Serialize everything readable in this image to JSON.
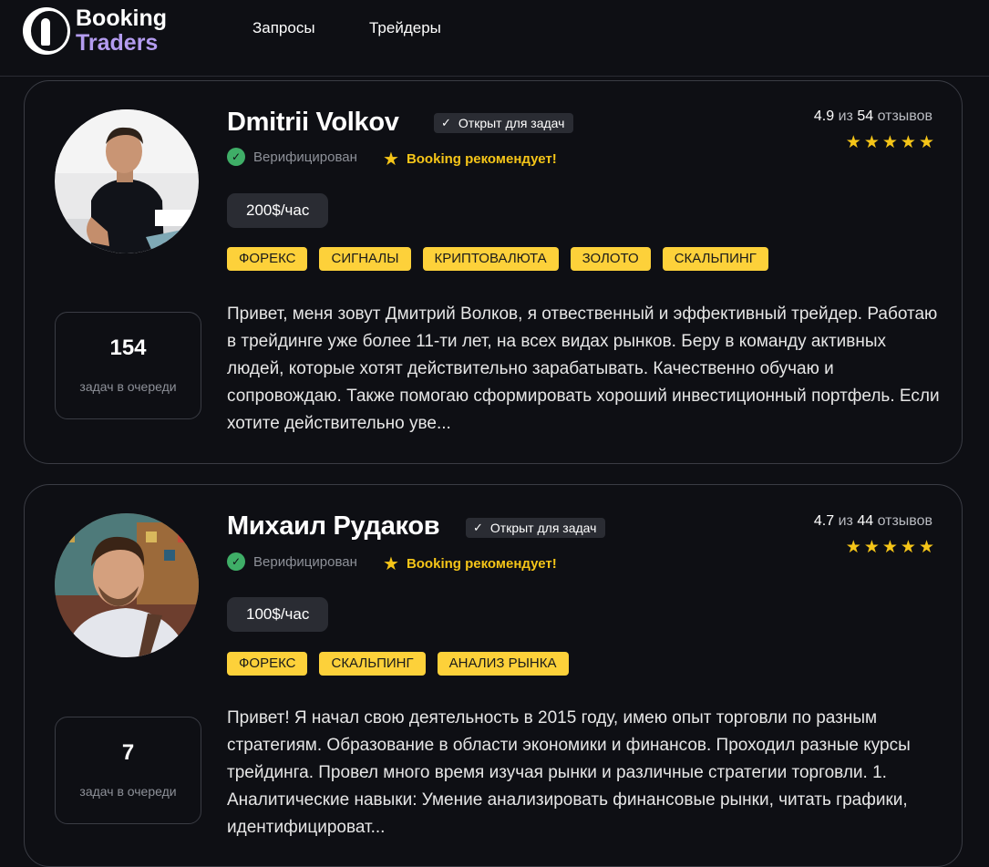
{
  "brand": {
    "line1": "Booking",
    "line2": "Traders"
  },
  "nav": {
    "items": [
      "Запросы",
      "Трейдеры"
    ]
  },
  "common": {
    "open_label": "Открыт для задач",
    "verified_label": "Верифицирован",
    "recommend_label": "Booking рекомендует!",
    "queue_label": "задач в очереди",
    "rating_of": "из",
    "rating_reviews": "отзывов"
  },
  "colors": {
    "accent_purple": "#b49cf0",
    "tag_yellow": "#fdd13a",
    "verified_green": "#3fae67",
    "star": "#f5c518"
  },
  "traders": [
    {
      "name": "Dmitrii Volkov",
      "rating": "4.9",
      "reviews": "54",
      "stars": 5,
      "price": "200$/час",
      "tags": [
        "ФОРЕКС",
        "СИГНАЛЫ",
        "КРИПТОВАЛЮТА",
        "ЗОЛОТО",
        "СКАЛЬПИНГ"
      ],
      "queue": "154",
      "about": "Привет, меня зовут Дмитрий Волков, я отвественный и эффективный трейдер. Работаю в трейдинге уже более 11-ти лет, на всех видах рынков. Беру в команду активных людей, которые хотят действительно зарабатывать. Качественно обучаю и сопровождаю. Также помогаю сформировать хороший инвестиционный портфель. Если хотите действительно уве..."
    },
    {
      "name": "Михаил Рудаков",
      "rating": "4.7",
      "reviews": "44",
      "stars": 5,
      "price": "100$/час",
      "tags": [
        "ФОРЕКС",
        "СКАЛЬПИНГ",
        "АНАЛИЗ РЫНКА"
      ],
      "queue": "7",
      "about": "Привет! Я начал свою деятельность в 2015 году, имею опыт торговли по разным стратегиям. Образование в области экономики и финансов. Проходил разные курсы трейдинга. Провел много время изучая рынки и различные стратегии торговли. 1. Аналитические навыки: Умение анализировать финансовые рынки, читать графики, идентифицироват..."
    }
  ]
}
